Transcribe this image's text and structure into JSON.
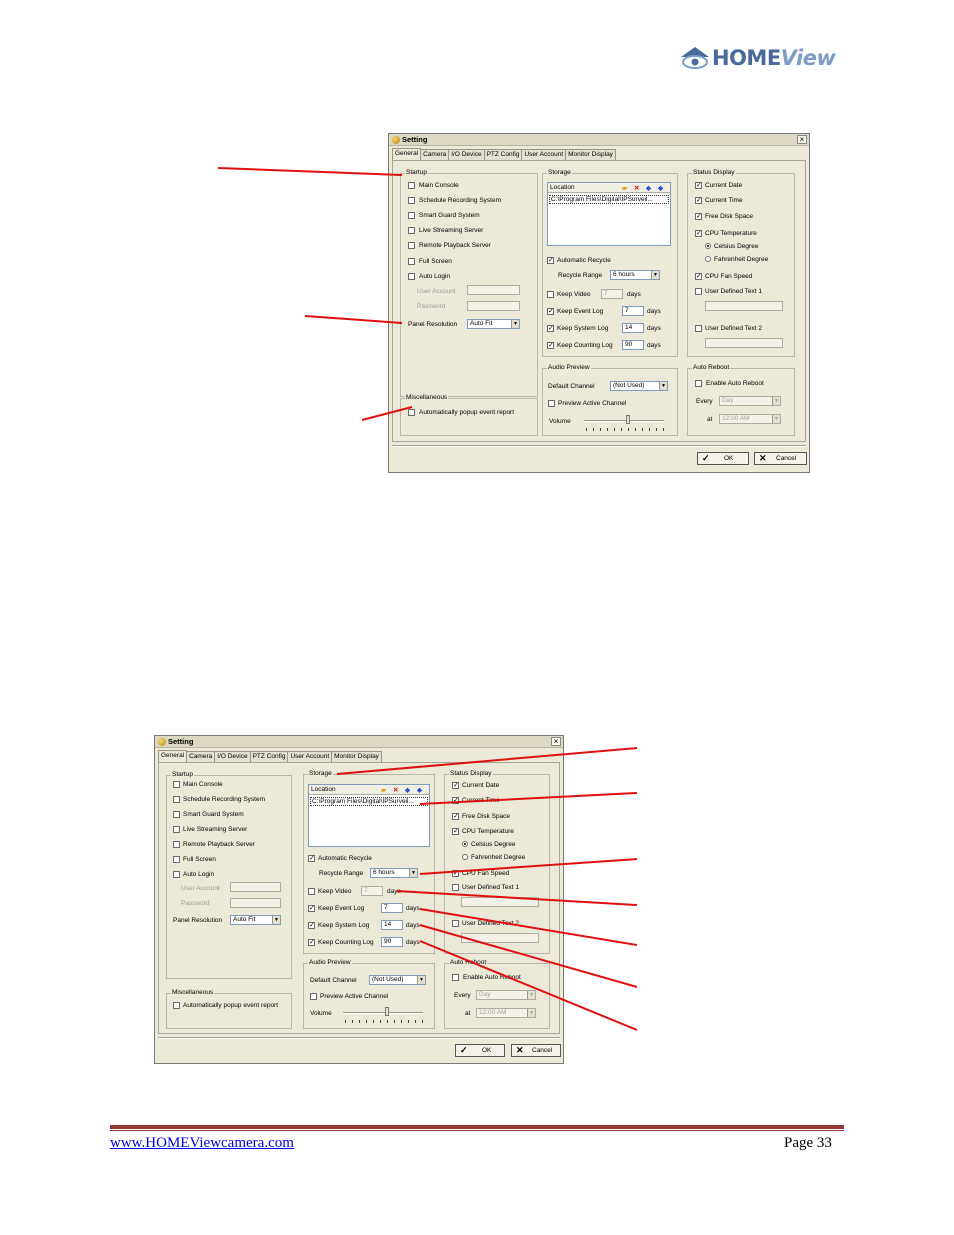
{
  "logo": {
    "home": "HOME",
    "view": "View"
  },
  "dialog": {
    "title": "Setting",
    "close": "×",
    "tabs": [
      "General",
      "Camera",
      "I/O Device",
      "PTZ Config",
      "User Account",
      "Monitor Display"
    ],
    "startup": {
      "label": "Startup",
      "items": [
        {
          "label": "Main Console",
          "checked": false
        },
        {
          "label": "Schedule Recording System",
          "checked": false
        },
        {
          "label": "Smart Guard System",
          "checked": false
        },
        {
          "label": "Live Streaming Server",
          "checked": false
        },
        {
          "label": "Remote Playback Server",
          "checked": false
        },
        {
          "label": "Full Screen",
          "checked": false
        },
        {
          "label": "Auto Login",
          "checked": false
        }
      ],
      "user_account": "User Account",
      "password": "Password",
      "panel_resolution": "Panel Resolution",
      "panel_resolution_value": "Auto Fit"
    },
    "misc": {
      "label": "Miscellaneous",
      "popup": "Automatically popup event report"
    },
    "storage": {
      "label": "Storage",
      "location_header": "Location",
      "location_row": "C:\\Program Files\\Digital\\IPSurveil...",
      "auto_recycle": "Automatic Recycle",
      "recycle_range": "Recycle Range",
      "recycle_range_value": "6 hours",
      "keep_video": "Keep Video",
      "keep_video_value": "7",
      "keep_event": "Keep Event Log",
      "keep_event_value": "7",
      "keep_system": "Keep System Log",
      "keep_system_value": "14",
      "keep_counting": "Keep Counting Log",
      "keep_counting_value": "90",
      "days": "days"
    },
    "audio": {
      "label": "Audio Preview",
      "default_channel": "Default Channel",
      "default_channel_value": "(Not Used)",
      "preview_active": "Preview Active Channel",
      "volume": "Volume",
      "volume_level": 0.55
    },
    "status": {
      "label": "Status Display",
      "current_date": "Current Date",
      "current_time": "Current Time",
      "free_disk": "Free Disk Space",
      "cpu_temp": "CPU Temperature",
      "celsius": "Celsius Degree",
      "fahrenheit": "Fahrenheit Degree",
      "cpu_fan": "CPU Fan Speed",
      "user_text1": "User Defined Text 1",
      "user_text2": "User Defined Text 2"
    },
    "reboot": {
      "label": "Auto Reboot",
      "enable": "Enable Auto Reboot",
      "every": "Every",
      "every_value": "Day",
      "at": "at",
      "at_value": "12:00 AM"
    },
    "ok": "OK",
    "cancel": "Cancel"
  },
  "footer": {
    "link": "www.HOMEViewcamera.com",
    "page": "Page 33"
  },
  "colors": {
    "arrow": "#e01010",
    "footer_rule": "#943634",
    "logo_dark": "#4a6a9c",
    "logo_light": "#7f9cc6"
  }
}
